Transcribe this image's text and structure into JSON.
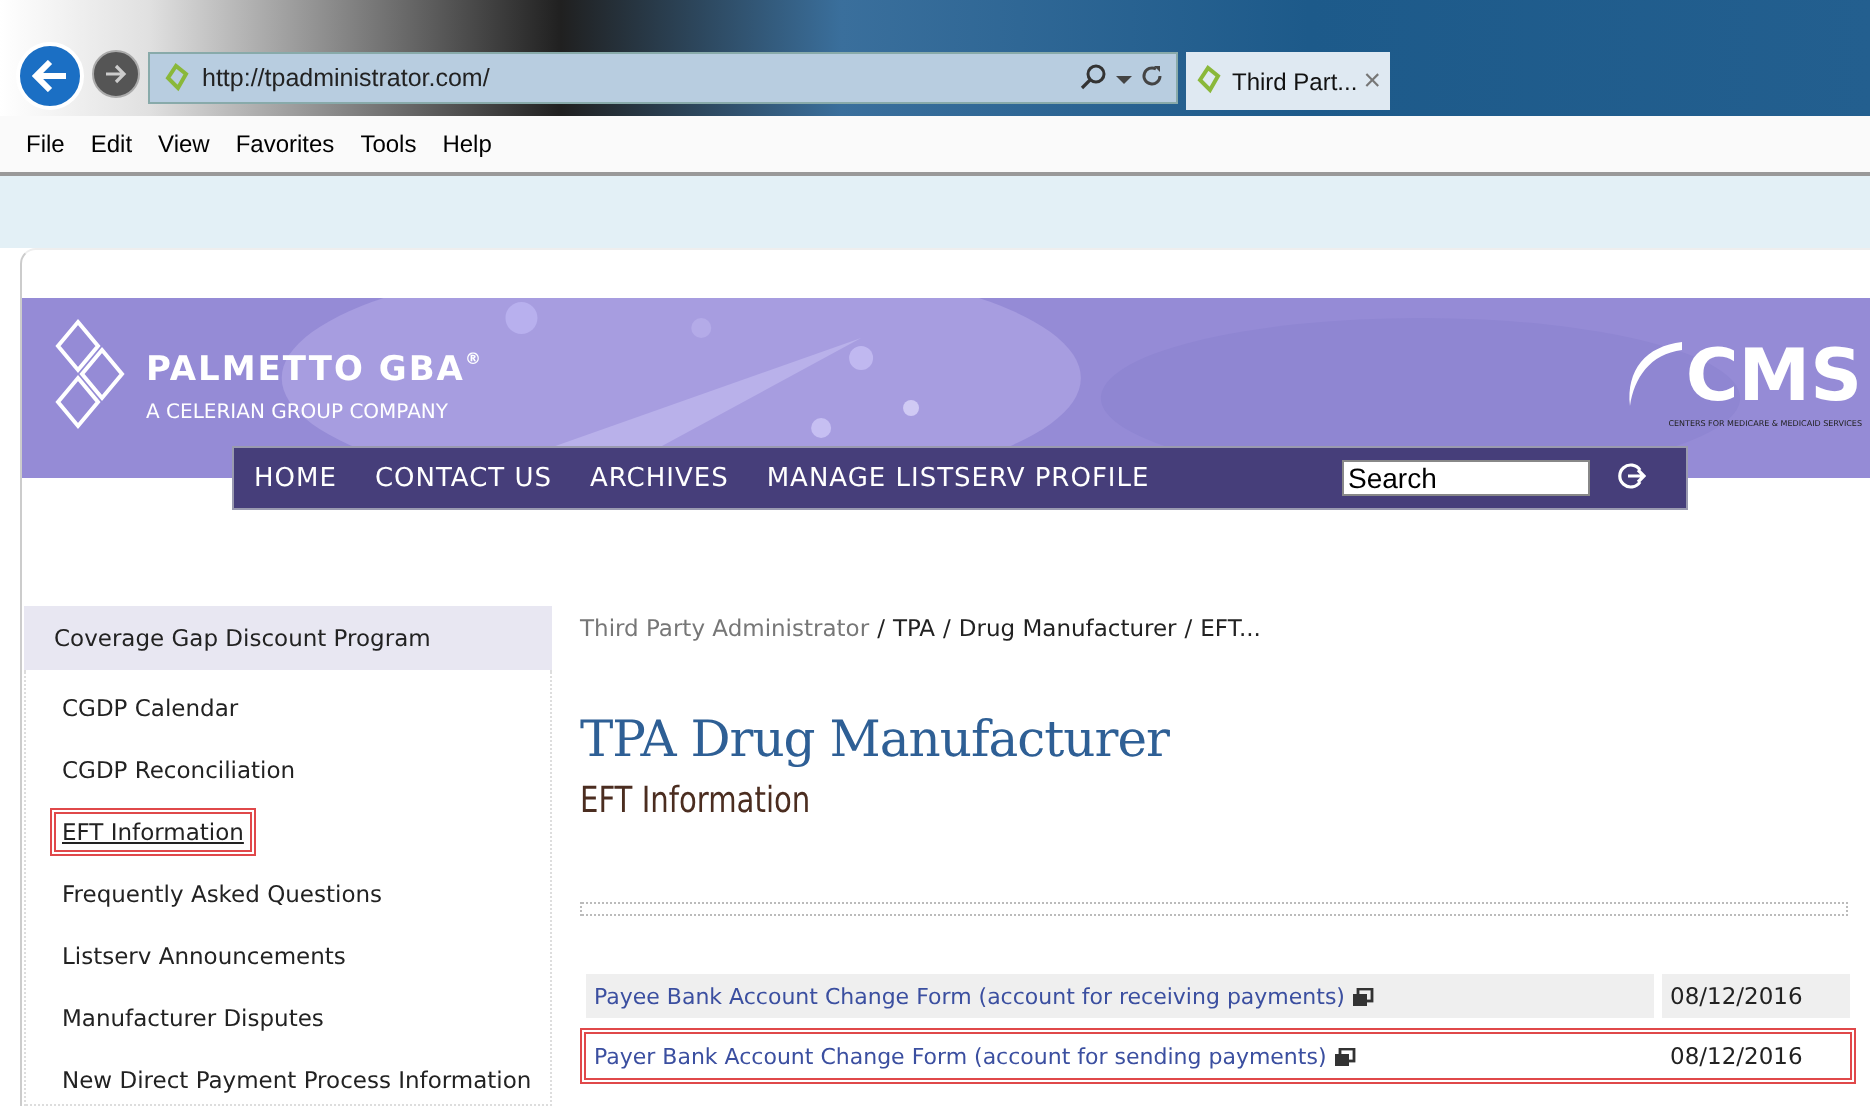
{
  "browser": {
    "address": "http://tpadministrator.com/",
    "tab": {
      "title": "Third Part...",
      "close": "×"
    },
    "menu": [
      "File",
      "Edit",
      "View",
      "Favorites",
      "Tools",
      "Help"
    ]
  },
  "header": {
    "logo_name": "PALMETTO GBA",
    "logo_mark": "®",
    "logo_tagline": "A CELERIAN GROUP COMPANY",
    "cms_logo": "CMS",
    "cms_tagline": "CENTERS FOR MEDICARE & MEDICAID SERVICES",
    "nav": [
      "HOME",
      "CONTACT US",
      "ARCHIVES",
      "MANAGE LISTSERV PROFILE"
    ],
    "search": {
      "value": "Search"
    }
  },
  "sidebar": {
    "title": "Coverage Gap Discount Program",
    "items": [
      {
        "label": "CGDP Calendar",
        "highlighted": false
      },
      {
        "label": "CGDP Reconciliation",
        "highlighted": false
      },
      {
        "label": "EFT Information",
        "highlighted": true
      },
      {
        "label": "Frequently Asked Questions",
        "highlighted": false
      },
      {
        "label": "Listserv Announcements",
        "highlighted": false
      },
      {
        "label": "Manufacturer Disputes",
        "highlighted": false
      },
      {
        "label": "New Direct Payment Process Information",
        "highlighted": false
      }
    ]
  },
  "breadcrumb": {
    "separator": "/",
    "items": [
      {
        "label": "Third Party Administrator",
        "kind": "link"
      },
      {
        "label": "TPA",
        "kind": "text"
      },
      {
        "label": "Drug Manufacturer",
        "kind": "text"
      },
      {
        "label": "EFT...",
        "kind": "text"
      }
    ]
  },
  "page": {
    "title": "TPA Drug Manufacturer",
    "subtitle": "EFT Information"
  },
  "documents": [
    {
      "title": "Payee Bank Account Change Form (account for receiving payments)",
      "date": "08/12/2016",
      "highlighted": false
    },
    {
      "title": "Payer Bank Account Change Form (account for sending payments)",
      "date": "08/12/2016",
      "highlighted": true
    }
  ]
}
